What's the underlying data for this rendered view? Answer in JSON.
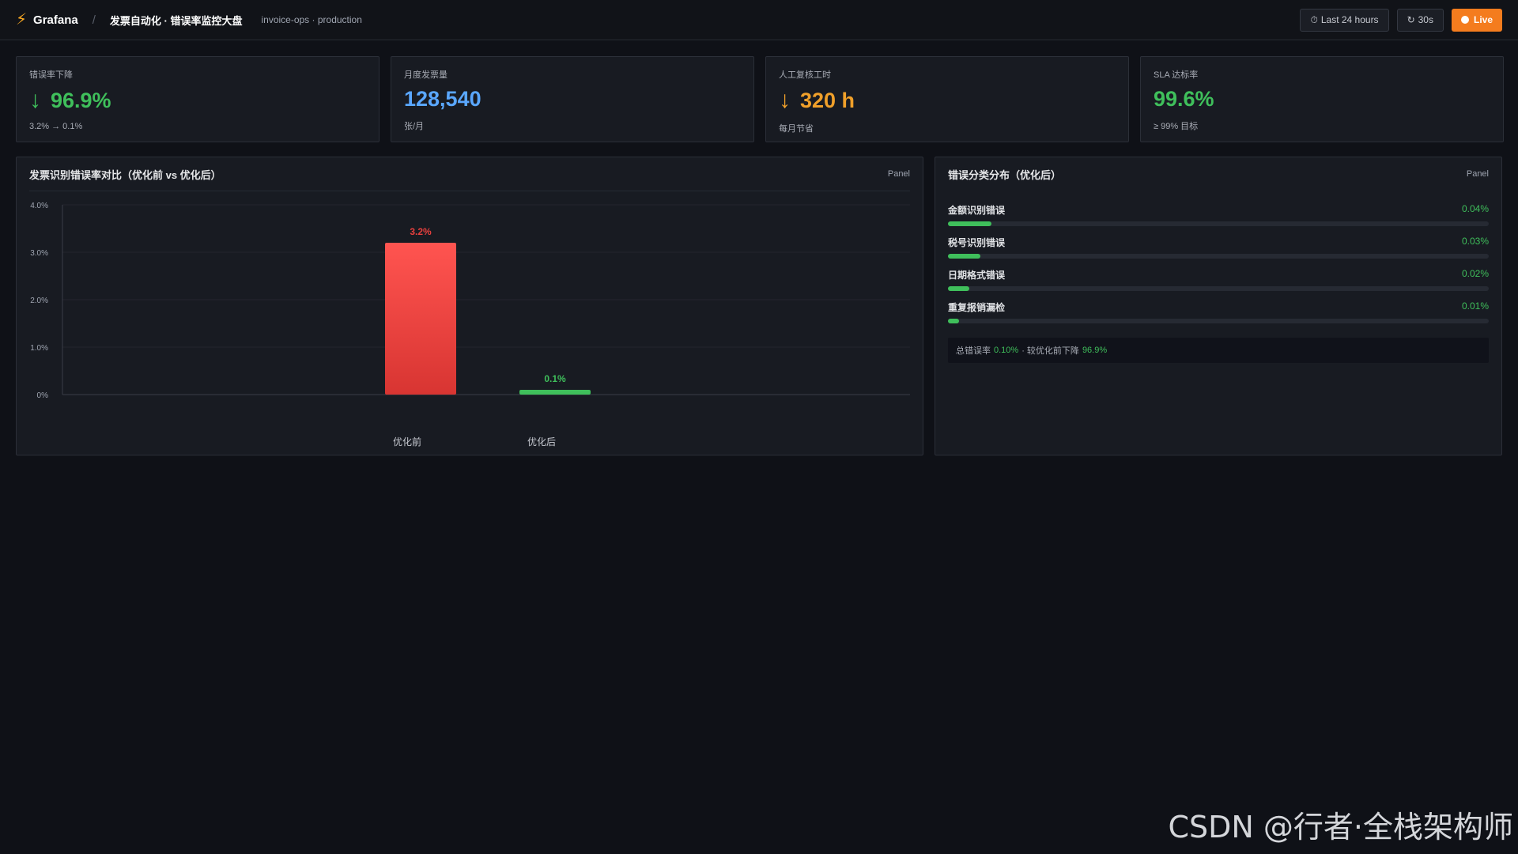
{
  "topbar": {
    "brand": "Grafana",
    "separator": "/",
    "dashboard_title": "发票自动化 · 错误率监控大盘",
    "environment": "invoice-ops · production",
    "time_range": "Last 24 hours",
    "refresh": "30s",
    "live_label": "Live",
    "time_icon": "clock-icon",
    "refresh_icon": "refresh-icon"
  },
  "stats": [
    {
      "label": "错误率下降",
      "arrow": "↓",
      "value": "96.9%",
      "sub": "3.2% → 0.1%",
      "color": "#3fbf5b"
    },
    {
      "label": "月度发票量",
      "arrow": "",
      "value": "128,540",
      "sub": "张/月",
      "color": "#5aa7ff"
    },
    {
      "label": "人工复核工时",
      "arrow": "↓",
      "value": "320 h",
      "sub": "每月节省",
      "color": "#f0a02a"
    },
    {
      "label": "SLA 达标率",
      "arrow": "",
      "value": "99.6%",
      "sub": "≥ 99% 目标",
      "color": "#3fbf5b"
    }
  ],
  "chart_panel": {
    "title": "发票识别错误率对比（优化前 vs 优化后）",
    "tag": "Panel"
  },
  "chart_data": {
    "type": "bar",
    "categories": [
      "优化前",
      "优化后"
    ],
    "values": [
      3.2,
      0.1
    ],
    "value_labels": [
      "3.2%",
      "0.1%"
    ],
    "colors": [
      "#e8403e",
      "#3fbf5b"
    ],
    "yticks": [
      "4.0%",
      "3.0%",
      "2.0%",
      "1.0%",
      "0%"
    ],
    "ytick_values": [
      4,
      3,
      2,
      1,
      0
    ],
    "ylim": [
      0,
      4
    ],
    "grid": true,
    "title": "",
    "xlabel": "",
    "ylabel": ""
  },
  "breakdown_panel": {
    "title": "错误分类分布（优化后）",
    "tag": "Panel",
    "items": [
      {
        "name": "金额识别错误",
        "value": "0.04%",
        "fraction": 0.04
      },
      {
        "name": "税号识别错误",
        "value": "0.03%",
        "fraction": 0.03
      },
      {
        "name": "日期格式错误",
        "value": "0.02%",
        "fraction": 0.02
      },
      {
        "name": "重复报销漏检",
        "value": "0.01%",
        "fraction": 0.01
      }
    ],
    "summary_prefix": "总错误率",
    "summary_total": "0.10%",
    "summary_mid": "· 较优化前下降",
    "summary_drop": "96.9%"
  },
  "watermark": "CSDN @行者·全栈架构师"
}
